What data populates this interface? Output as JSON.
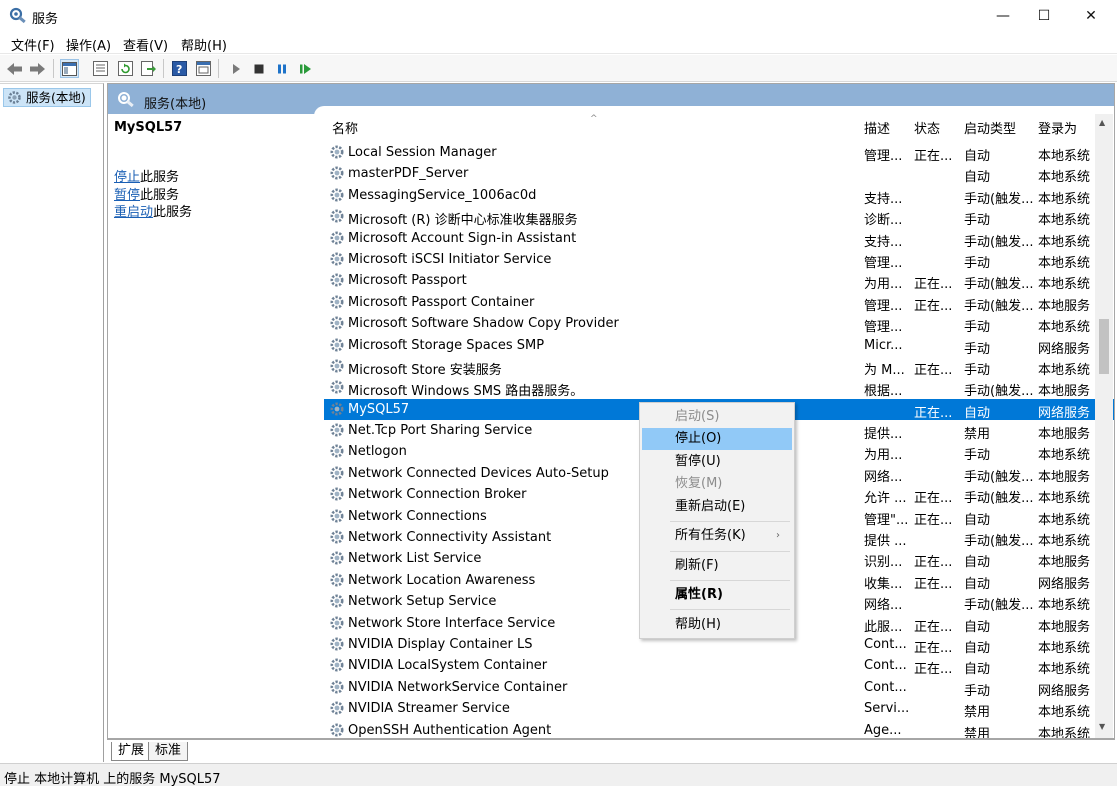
{
  "window": {
    "title": "服务",
    "min_label": "—",
    "max_label": "☐",
    "close_label": "✕"
  },
  "menu": [
    "文件(F)",
    "操作(A)",
    "查看(V)",
    "帮助(H)"
  ],
  "tree": {
    "root_label": "服务(本地)"
  },
  "panel": {
    "header": "服务(本地)",
    "service_title": "MySQL57",
    "actions": [
      {
        "link": "停止",
        "text": "此服务"
      },
      {
        "link": "暂停",
        "text": "此服务"
      },
      {
        "link": "重启动",
        "text": "此服务"
      }
    ]
  },
  "table": {
    "columns": {
      "name": "名称",
      "desc": "描述",
      "status": "状态",
      "start": "启动类型",
      "logon": "登录为"
    },
    "sort_arrow": "^",
    "rows": [
      {
        "name": "Local Session Manager",
        "desc": "管理...",
        "status": "正在...",
        "start": "自动",
        "logon": "本地系统"
      },
      {
        "name": "masterPDF_Server",
        "desc": "",
        "status": "",
        "start": "自动",
        "logon": "本地系统"
      },
      {
        "name": "MessagingService_1006ac0d",
        "desc": "支持...",
        "status": "",
        "start": "手动(触发...",
        "logon": "本地系统"
      },
      {
        "name": "Microsoft (R) 诊断中心标准收集器服务",
        "desc": "诊断...",
        "status": "",
        "start": "手动",
        "logon": "本地系统"
      },
      {
        "name": "Microsoft Account Sign-in Assistant",
        "desc": "支持...",
        "status": "",
        "start": "手动(触发...",
        "logon": "本地系统"
      },
      {
        "name": "Microsoft iSCSI Initiator Service",
        "desc": "管理...",
        "status": "",
        "start": "手动",
        "logon": "本地系统"
      },
      {
        "name": "Microsoft Passport",
        "desc": "为用...",
        "status": "正在...",
        "start": "手动(触发...",
        "logon": "本地系统"
      },
      {
        "name": "Microsoft Passport Container",
        "desc": "管理...",
        "status": "正在...",
        "start": "手动(触发...",
        "logon": "本地服务"
      },
      {
        "name": "Microsoft Software Shadow Copy Provider",
        "desc": "管理...",
        "status": "",
        "start": "手动",
        "logon": "本地系统"
      },
      {
        "name": "Microsoft Storage Spaces SMP",
        "desc": "Micr...",
        "status": "",
        "start": "手动",
        "logon": "网络服务"
      },
      {
        "name": "Microsoft Store 安装服务",
        "desc": "为 M...",
        "status": "正在...",
        "start": "手动",
        "logon": "本地系统"
      },
      {
        "name": "Microsoft Windows SMS 路由器服务。",
        "desc": "根据...",
        "status": "",
        "start": "手动(触发...",
        "logon": "本地服务"
      },
      {
        "name": "MySQL57",
        "desc": "",
        "status": "正在...",
        "start": "自动",
        "logon": "网络服务",
        "selected": true
      },
      {
        "name": "Net.Tcp Port Sharing Service",
        "desc": "提供...",
        "status": "",
        "start": "禁用",
        "logon": "本地服务"
      },
      {
        "name": "Netlogon",
        "desc": "为用...",
        "status": "",
        "start": "手动",
        "logon": "本地系统"
      },
      {
        "name": "Network Connected Devices Auto-Setup",
        "desc": "网络...",
        "status": "",
        "start": "手动(触发...",
        "logon": "本地服务"
      },
      {
        "name": "Network Connection Broker",
        "desc": "允许 ...",
        "status": "正在...",
        "start": "手动(触发...",
        "logon": "本地系统"
      },
      {
        "name": "Network Connections",
        "desc": "管理\"...",
        "status": "正在...",
        "start": "自动",
        "logon": "本地系统"
      },
      {
        "name": "Network Connectivity Assistant",
        "desc": "提供 ...",
        "status": "",
        "start": "手动(触发...",
        "logon": "本地系统"
      },
      {
        "name": "Network List Service",
        "desc": "识别...",
        "status": "正在...",
        "start": "自动",
        "logon": "本地服务"
      },
      {
        "name": "Network Location Awareness",
        "desc": "收集...",
        "status": "正在...",
        "start": "自动",
        "logon": "网络服务"
      },
      {
        "name": "Network Setup Service",
        "desc": "网络...",
        "status": "",
        "start": "手动(触发...",
        "logon": "本地系统"
      },
      {
        "name": "Network Store Interface Service",
        "desc": "此服...",
        "status": "正在...",
        "start": "自动",
        "logon": "本地服务"
      },
      {
        "name": "NVIDIA Display Container LS",
        "desc": "Cont...",
        "status": "正在...",
        "start": "自动",
        "logon": "本地系统"
      },
      {
        "name": "NVIDIA LocalSystem Container",
        "desc": "Cont...",
        "status": "正在...",
        "start": "自动",
        "logon": "本地系统"
      },
      {
        "name": "NVIDIA NetworkService Container",
        "desc": "Cont...",
        "status": "",
        "start": "手动",
        "logon": "网络服务"
      },
      {
        "name": "NVIDIA Streamer Service",
        "desc": "Servi...",
        "status": "",
        "start": "禁用",
        "logon": "本地系统"
      },
      {
        "name": "OpenSSH Authentication Agent",
        "desc": "Age...",
        "status": "",
        "start": "禁用",
        "logon": "本地系统"
      }
    ]
  },
  "context_menu": {
    "start": "启动(S)",
    "stop": "停止(O)",
    "pause": "暂停(U)",
    "resume": "恢复(M)",
    "restart": "重新启动(E)",
    "all_tasks": "所有任务(K)",
    "submenu_arrow": "›",
    "refresh": "刷新(F)",
    "properties": "属性(R)",
    "help": "帮助(H)"
  },
  "tabs": [
    "扩展",
    "标准"
  ],
  "status_text": "停止 本地计算机 上的服务 MySQL57",
  "colors": {
    "selection": "#0078d7",
    "header_band": "#8fb1d6",
    "menu_hover": "#91c9f7",
    "link": "#1a5fb4"
  }
}
